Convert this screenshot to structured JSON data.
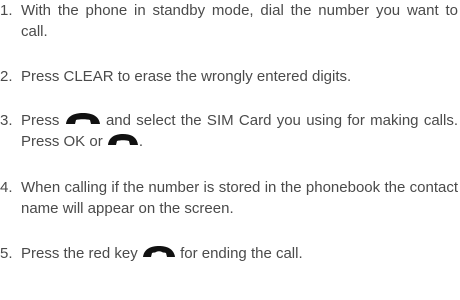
{
  "steps": [
    {
      "number": "1.",
      "text": "With the phone in standby mode, dial the number you want to call."
    },
    {
      "number": "2.",
      "text": "Press CLEAR to erase the wrongly entered digits."
    },
    {
      "number": "3.",
      "text_before_icon": "Press",
      "text_after_icon": "and select the SIM Card you using for making calls. Press OK or",
      "text_end": "."
    },
    {
      "number": "4.",
      "text": "When calling if the number is stored in the phonebook the contact name will appear on the screen."
    },
    {
      "number": "5.",
      "text_before_icon": "Press the red key",
      "text_after_icon": "for ending the call."
    }
  ],
  "icons": {
    "call_key": "call-handset-icon",
    "end_key": "end-call-handset-icon",
    "icon_color": "#111111"
  }
}
